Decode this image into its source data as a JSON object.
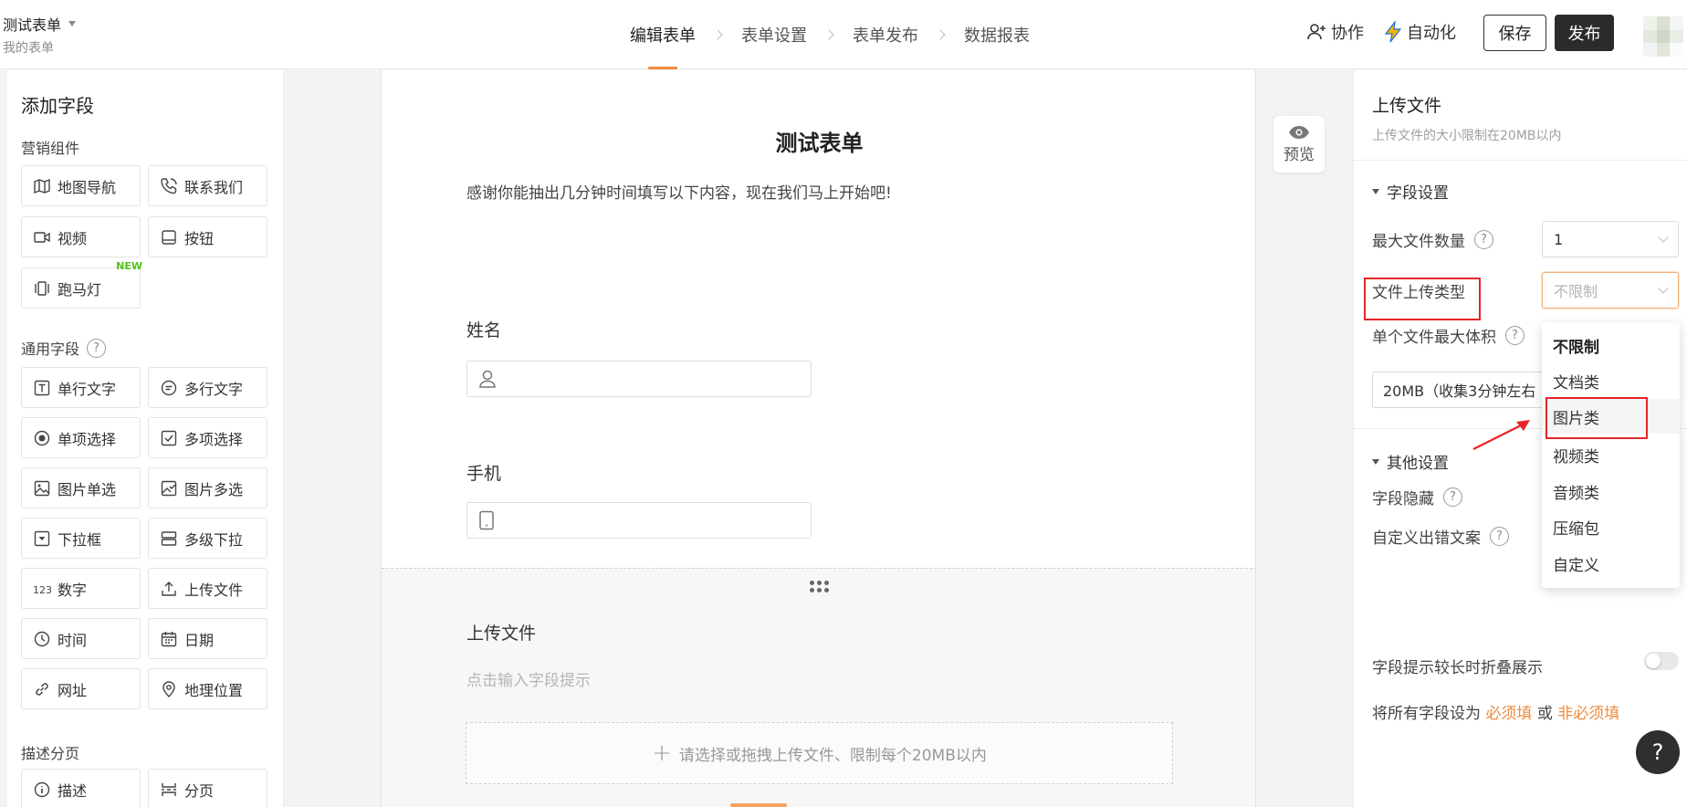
{
  "header": {
    "form_title": "测试表单",
    "form_subtitle": "我的表单",
    "steps": [
      "编辑表单",
      "表单设置",
      "表单发布",
      "数据报表"
    ],
    "active_step_index": 0,
    "collab_label": "协作",
    "automation_label": "自动化",
    "save_label": "保存",
    "publish_label": "发布"
  },
  "left_panel": {
    "title": "添加字段",
    "groups": [
      {
        "name": "营销组件",
        "has_help": false,
        "items": [
          {
            "label": "地图导航",
            "icon": "map-icon"
          },
          {
            "label": "联系我们",
            "icon": "phone-icon"
          },
          {
            "label": "视频",
            "icon": "video-icon"
          },
          {
            "label": "按钮",
            "icon": "button-icon"
          },
          {
            "label": "跑马灯",
            "icon": "carousel-icon",
            "badge": "NEW"
          }
        ]
      },
      {
        "name": "通用字段",
        "has_help": true,
        "items": [
          {
            "label": "单行文字",
            "icon": "single-line-text-icon"
          },
          {
            "label": "多行文字",
            "icon": "multi-line-text-icon"
          },
          {
            "label": "单项选择",
            "icon": "radio-icon"
          },
          {
            "label": "多项选择",
            "icon": "checkbox-icon"
          },
          {
            "label": "图片单选",
            "icon": "image-radio-icon"
          },
          {
            "label": "图片多选",
            "icon": "image-checkbox-icon"
          },
          {
            "label": "下拉框",
            "icon": "dropdown-icon"
          },
          {
            "label": "多级下拉",
            "icon": "cascade-icon"
          },
          {
            "label": "数字",
            "icon": "number-icon"
          },
          {
            "label": "上传文件",
            "icon": "upload-icon"
          },
          {
            "label": "时间",
            "icon": "clock-icon"
          },
          {
            "label": "日期",
            "icon": "calendar-icon"
          },
          {
            "label": "网址",
            "icon": "link-icon"
          },
          {
            "label": "地理位置",
            "icon": "location-icon"
          }
        ]
      },
      {
        "name": "描述分页",
        "has_help": false,
        "items": [
          {
            "label": "描述",
            "icon": "info-icon"
          },
          {
            "label": "分页",
            "icon": "pagination-icon"
          }
        ]
      }
    ]
  },
  "canvas": {
    "title": "测试表单",
    "description": "感谢你能抽出几分钟时间填写以下内容，现在我们马上开始吧!",
    "fields": [
      {
        "label": "姓名",
        "icon": "person-icon"
      },
      {
        "label": "手机",
        "icon": "mobile-icon"
      }
    ],
    "upload": {
      "label": "上传文件",
      "hint_placeholder": "点击输入字段提示",
      "drop_text": "请选择或拖拽上传文件、限制每个20MB以内"
    }
  },
  "preview_label": "预览",
  "right_panel": {
    "title": "上传文件",
    "subtitle": "上传文件的大小限制在20MB以内",
    "field_settings_label": "字段设置",
    "max_files_label": "最大文件数量",
    "max_files_value": "1",
    "file_type_label": "文件上传类型",
    "file_type_placeholder": "不限制",
    "max_size_label": "单个文件最大体积",
    "max_size_value": "20MB（收集3分钟左右",
    "other_settings_label": "其他设置",
    "hide_field_label": "字段隐藏",
    "custom_error_label": "自定义出错文案",
    "collapse_hint_label": "字段提示较长时折叠展示",
    "collapse_hint_enabled": false,
    "required_prefix": "将所有字段设为",
    "required_link": "必须填",
    "required_or": "或",
    "optional_link": "非必须填"
  },
  "file_type_dropdown": {
    "options": [
      "不限制",
      "文档类",
      "图片类",
      "视频类",
      "音频类",
      "压缩包",
      "自定义"
    ],
    "selected_index": 0,
    "hovered_index": 2
  },
  "colors": {
    "accent": "#f08b3c",
    "annotation_red": "#e52626",
    "publish_bg": "#2b2b2b"
  },
  "help_fab_label": "?"
}
